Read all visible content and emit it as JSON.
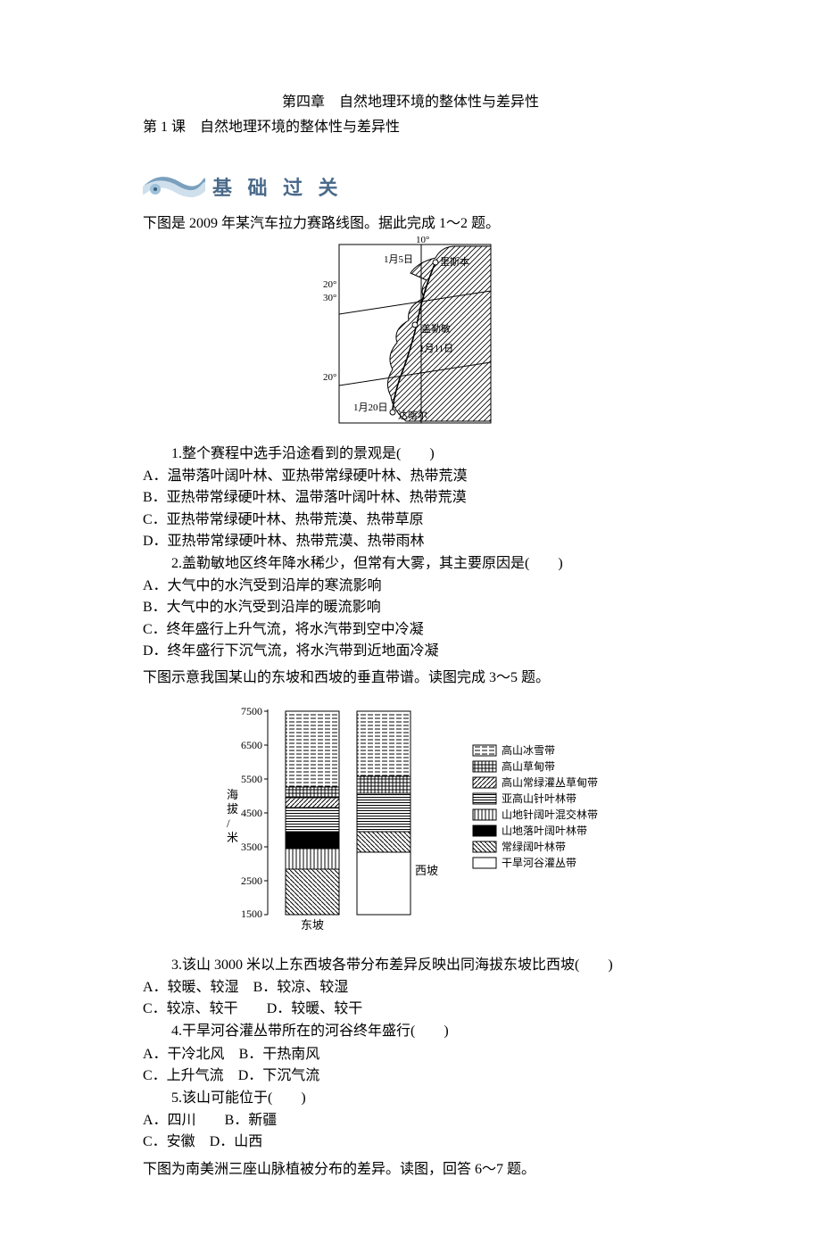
{
  "chapter": "第四章　自然地理环境的整体性与差异性",
  "lesson": "第 1 课　自然地理环境的整体性与差异性",
  "badge_label": "基 础 过 关",
  "section1_intro": "下图是 2009 年某汽车拉力赛路线图。据此完成 1～2 题。",
  "map_labels": {
    "lon": "10°",
    "lat20n": "20°",
    "lat30n": "30°",
    "lat20s": "20°",
    "city1": "里斯本",
    "date1": "1月5日",
    "city2": "盖勒敏",
    "date2": "1月11日",
    "date3": "1月20日",
    "city3": "达喀尔"
  },
  "q1": {
    "stem": "1.整个赛程中选手沿途看到的景观是(　　)",
    "A": "A．温带落叶阔叶林、亚热带常绿硬叶林、热带荒漠",
    "B": "B．亚热带常绿硬叶林、温带落叶阔叶林、热带荒漠",
    "C": "C．亚热带常绿硬叶林、热带荒漠、热带草原",
    "D": "D．亚热带常绿硬叶林、热带荒漠、热带雨林"
  },
  "q2": {
    "stem": "2.盖勒敏地区终年降水稀少，但常有大雾，其主要原因是(　　)",
    "A": "A．大气中的水汽受到沿岸的寒流影响",
    "B": "B．大气中的水汽受到沿岸的暖流影响",
    "C": "C．终年盛行上升气流，将水汽带到空中冷凝",
    "D": "D．终年盛行下沉气流，将水汽带到近地面冷凝"
  },
  "section2_intro": "下图示意我国某山的东坡和西坡的垂直带谱。读图完成 3～5 题。",
  "legend": {
    "ice": "高山冰雪带",
    "meadow": "高山草甸带",
    "shrub": "高山常绿灌丛草甸带",
    "conif": "亚高山针叶林带",
    "mixed": "山地针阔叶混交林带",
    "decid": "山地落叶阔叶林带",
    "ever": "常绿阔叶林带",
    "dry": "干旱河谷灌丛带"
  },
  "chart_axis": {
    "ylabel": "海拔/米",
    "xleft": "东坡",
    "xright": "西坡",
    "ticks": [
      "1500",
      "2500",
      "3500",
      "4500",
      "5500",
      "6500",
      "7500"
    ]
  },
  "q3": {
    "stem": "3.该山 3000 米以上东西坡各带分布差异反映出同海拔东坡比西坡(　　)",
    "A": "A．较暖、较湿",
    "B": "B．较凉、较湿",
    "C": "C．较凉、较干",
    "D": "D．较暖、较干"
  },
  "q4": {
    "stem": "4.干旱河谷灌丛带所在的河谷终年盛行(　　)",
    "A": "A．干冷北风",
    "B": "B．干热南风",
    "C": "C．上升气流",
    "D": "D．下沉气流"
  },
  "q5": {
    "stem": "5.该山可能位于(　　)",
    "A": "A．四川",
    "B": "B．新疆",
    "C": "C．安徽",
    "D": "D．山西"
  },
  "section3_intro": "下图为南美洲三座山脉植被分布的差异。读图，回答 6～7 题。",
  "chart_data": [
    {
      "type": "map-route",
      "title": "2009年某汽车拉力赛路线图",
      "longitude_line_deg": 10,
      "latitude_lines_deg": [
        20,
        30
      ],
      "waypoints": [
        {
          "name": "里斯本",
          "date": "1月5日",
          "approx_lat": 38,
          "approx_lon": -9
        },
        {
          "name": "盖勒敏",
          "date": "1月11日",
          "approx_lat": 29,
          "approx_lon": -10
        },
        {
          "name": "达喀尔",
          "date": "1月20日",
          "approx_lat": 15,
          "approx_lon": -17
        }
      ],
      "ocean_side": "west",
      "land_side": "east_hatched"
    },
    {
      "type": "stacked-column",
      "title": "某山东坡与西坡垂直带谱",
      "ylabel": "海拔/米",
      "ylim": [
        1500,
        7500
      ],
      "series": [
        {
          "name": "东坡",
          "bands": [
            {
              "belt": "常绿阔叶林带",
              "from": 1500,
              "to": 2300
            },
            {
              "belt": "山地针阔叶混交林带",
              "from": 2300,
              "to": 2900
            },
            {
              "belt": "山地落叶阔叶林带",
              "from": 2900,
              "to": 3400
            },
            {
              "belt": "亚高山针叶林带",
              "from": 3400,
              "to": 4100
            },
            {
              "belt": "高山常绿灌丛草甸带",
              "from": 4100,
              "to": 4400
            },
            {
              "belt": "高山草甸带",
              "from": 4400,
              "to": 4700
            },
            {
              "belt": "高山冰雪带",
              "from": 4700,
              "to": 7500
            }
          ]
        },
        {
          "name": "西坡",
          "bands": [
            {
              "belt": "干旱河谷灌丛带",
              "from": 1500,
              "to": 2800
            },
            {
              "belt": "常绿阔叶林带",
              "from": 2800,
              "to": 3400
            },
            {
              "belt": "亚高山针叶林带",
              "from": 3400,
              "to": 4500
            },
            {
              "belt": "高山草甸带",
              "from": 4500,
              "to": 5000
            },
            {
              "belt": "高山冰雪带",
              "from": 5000,
              "to": 7500
            }
          ]
        }
      ]
    }
  ]
}
